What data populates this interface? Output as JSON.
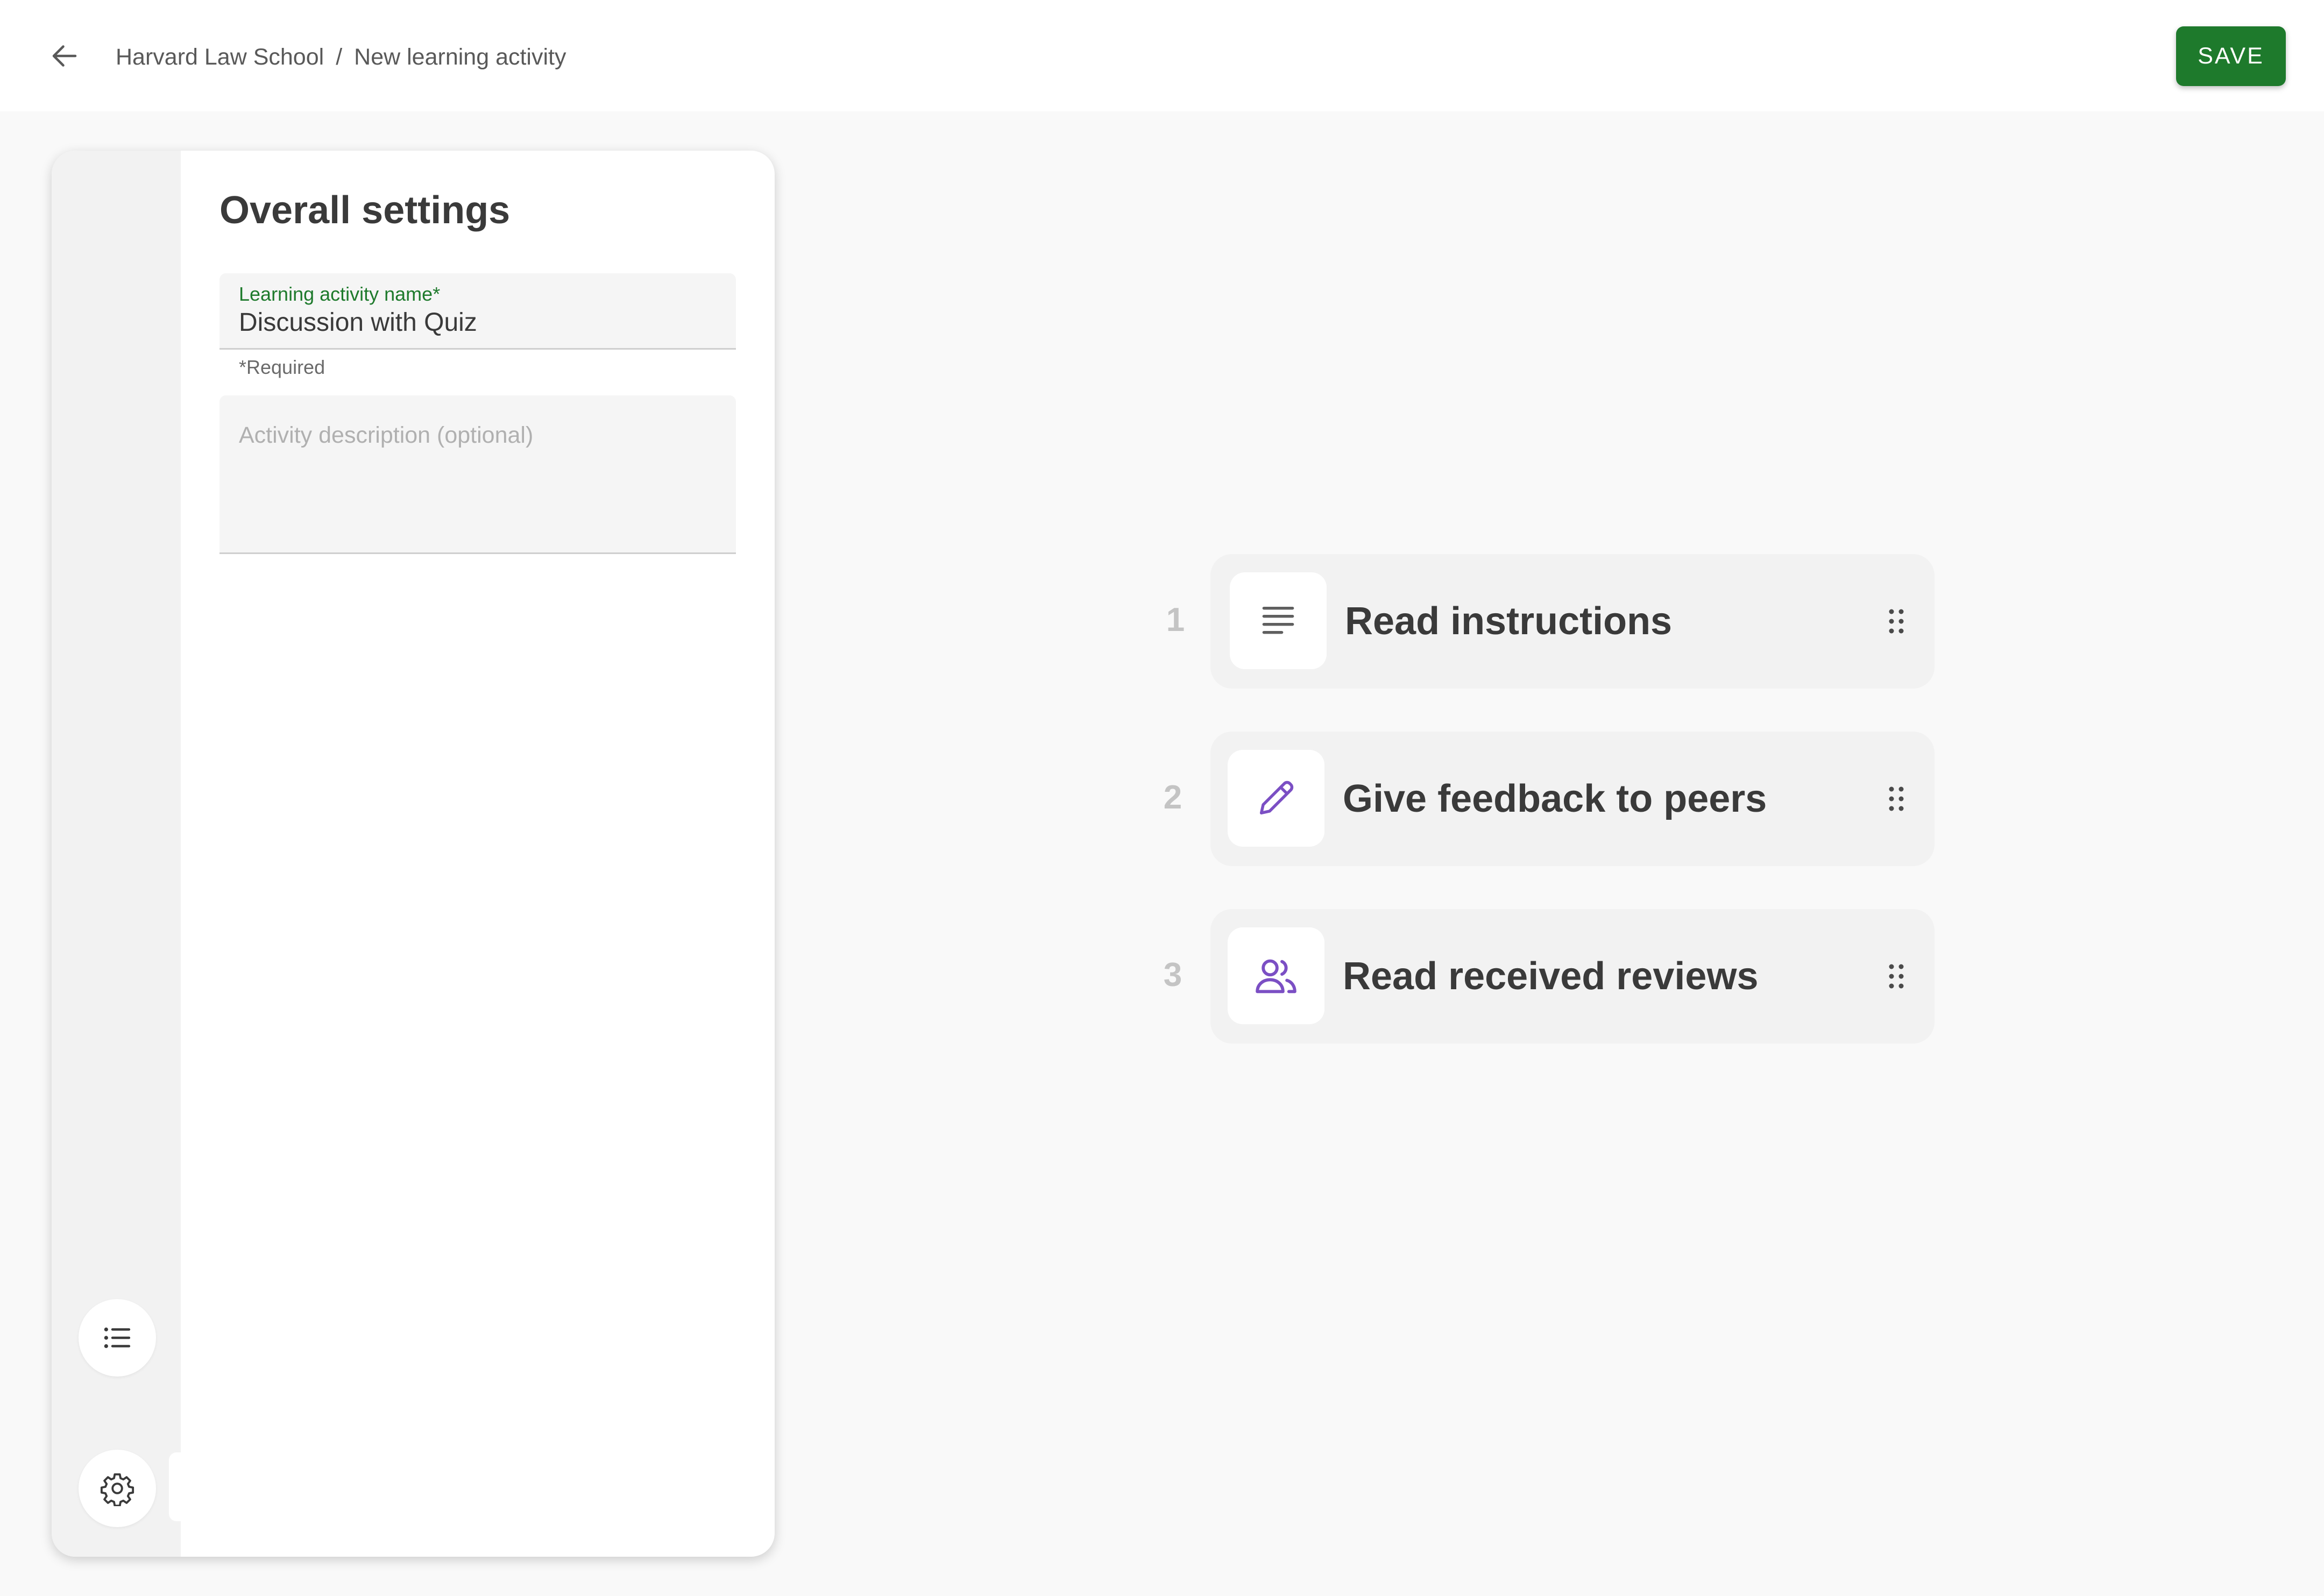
{
  "header": {
    "back_icon": "arrow-left-icon",
    "breadcrumb": {
      "parent": "Harvard Law School",
      "separator": "/",
      "current": "New learning activity"
    },
    "save_label": "SAVE"
  },
  "settings": {
    "title": "Overall settings",
    "name_field": {
      "label": "Learning activity name*",
      "value": "Discussion with Quiz",
      "helper": "*Required"
    },
    "description_field": {
      "placeholder": "Activity description (optional)",
      "value": ""
    },
    "rail": {
      "list_icon": "list-icon",
      "settings_icon": "gear-icon"
    }
  },
  "steps": [
    {
      "number": "1",
      "label": "Read instructions",
      "icon": "text-lines-icon"
    },
    {
      "number": "2",
      "label": "Give feedback to peers",
      "icon": "pencil-icon"
    },
    {
      "number": "3",
      "label": "Read received reviews",
      "icon": "people-icon"
    }
  ],
  "colors": {
    "accent_green": "#1e7a2c",
    "icon_purple": "#7b4fc4",
    "icon_gray": "#5f5f5f"
  }
}
